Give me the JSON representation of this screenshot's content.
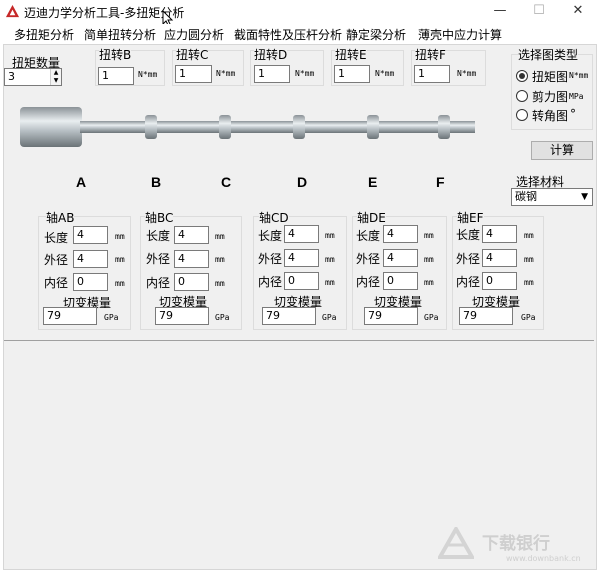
{
  "window": {
    "title": "迈迪力学分析工具-多扭矩分析",
    "minimize": "—",
    "maximize": "☐",
    "close": "✕"
  },
  "menu": [
    "多扭矩分析",
    "简单扭转分析",
    "应力圆分析",
    "截面特性及压杆分析",
    "静定梁分析",
    "薄壳中应力计算"
  ],
  "torque_count": {
    "label": "扭矩数量",
    "value": "3"
  },
  "torques": [
    {
      "label": "扭转B",
      "value": "1",
      "unit": "N*mm"
    },
    {
      "label": "扭转C",
      "value": "1",
      "unit": "N*mm"
    },
    {
      "label": "扭转D",
      "value": "1",
      "unit": "N*mm"
    },
    {
      "label": "扭转E",
      "value": "1",
      "unit": "N*mm"
    },
    {
      "label": "扭转F",
      "value": "1",
      "unit": "N*mm"
    }
  ],
  "chart_type": {
    "title": "选择图类型",
    "options": [
      {
        "label": "扭矩图",
        "unit": "N*mm",
        "selected": true
      },
      {
        "label": "剪力图",
        "unit": "MPa",
        "selected": false
      },
      {
        "label": "转角图",
        "unit": "°",
        "selected": false
      }
    ]
  },
  "calc_button": "计算",
  "material": {
    "label": "选择材料",
    "value": "碳钢"
  },
  "points": [
    "A",
    "B",
    "C",
    "D",
    "E",
    "F"
  ],
  "shafts": [
    {
      "title": "轴AB",
      "length": "4",
      "outer": "4",
      "inner": "0",
      "modulus": "79"
    },
    {
      "title": "轴BC",
      "length": "4",
      "outer": "4",
      "inner": "0",
      "modulus": "79"
    },
    {
      "title": "轴CD",
      "length": "4",
      "outer": "4",
      "inner": "0",
      "modulus": "79"
    },
    {
      "title": "轴DE",
      "length": "4",
      "outer": "4",
      "inner": "0",
      "modulus": "79"
    },
    {
      "title": "轴EF",
      "length": "4",
      "outer": "4",
      "inner": "0",
      "modulus": "79"
    }
  ],
  "shaft_labels": {
    "length": "长度",
    "outer": "外径",
    "inner": "内径",
    "modulus": "切变模量",
    "mm": "mm",
    "gpa": "GPa"
  },
  "watermark": {
    "main": "下载银行",
    "sub": "www.downbank.cn"
  },
  "colors": {
    "shaft": "#b9c1c6",
    "background": "#f0f0f0"
  }
}
